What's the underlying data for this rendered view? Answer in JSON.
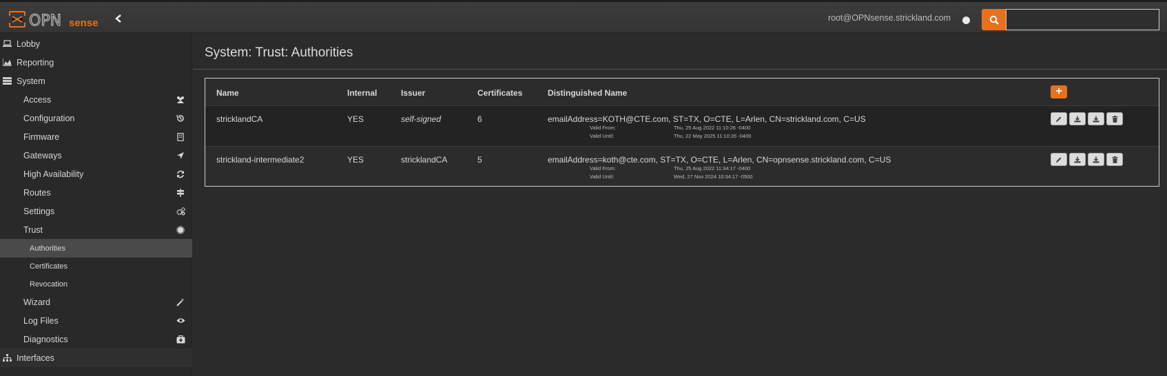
{
  "header": {
    "brand": {
      "primary": "OPN",
      "secondary": "sense"
    },
    "user": "root@OPNsense.strickland.com",
    "search_placeholder": "",
    "accent_color": "#e8711c"
  },
  "sidebar": {
    "top_items": [
      {
        "label": "Lobby",
        "icon": "laptop-icon"
      },
      {
        "label": "Reporting",
        "icon": "area-chart-icon"
      },
      {
        "label": "System",
        "icon": "server-icon"
      }
    ],
    "system_items": [
      {
        "label": "Access",
        "icon": "users-icon"
      },
      {
        "label": "Configuration",
        "icon": "history-icon"
      },
      {
        "label": "Firmware",
        "icon": "building-icon"
      },
      {
        "label": "Gateways",
        "icon": "location-arrow-icon"
      },
      {
        "label": "High Availability",
        "icon": "refresh-icon"
      },
      {
        "label": "Routes",
        "icon": "map-signs-icon"
      },
      {
        "label": "Settings",
        "icon": "cogs-icon"
      },
      {
        "label": "Trust",
        "icon": "certificate-icon"
      }
    ],
    "trust_items": [
      {
        "label": "Authorities",
        "active": true
      },
      {
        "label": "Certificates",
        "active": false
      },
      {
        "label": "Revocation",
        "active": false
      }
    ],
    "more_system_items": [
      {
        "label": "Wizard",
        "icon": "magic-icon"
      },
      {
        "label": "Log Files",
        "icon": "eye-icon"
      },
      {
        "label": "Diagnostics",
        "icon": "medkit-icon"
      }
    ],
    "bottom_items": [
      {
        "label": "Interfaces",
        "icon": "sitemap-icon"
      }
    ]
  },
  "main": {
    "title": "System: Trust: Authorities",
    "columns": [
      "Name",
      "Internal",
      "Issuer",
      "Certificates",
      "Distinguished Name"
    ],
    "rows": [
      {
        "name": "stricklandCA",
        "internal": "YES",
        "issuer": "self-signed",
        "certificates": "6",
        "dn": "emailAddress=KOTH@CTE.com, ST=TX, O=CTE, L=Arlen, CN=strickland.com, C=US",
        "valid_from_label": "Valid From:",
        "valid_from": "Thu, 25 Aug 2022 11:10:26 -0400",
        "valid_until_label": "Valid Until:",
        "valid_until": "Thu, 22 May 2025 11:10:26 -0400"
      },
      {
        "name": "strickland-intermediate2",
        "internal": "YES",
        "issuer": "stricklandCA",
        "certificates": "5",
        "dn": "emailAddress=koth@cte.com, ST=TX, O=CTE, L=Arlen, CN=opnsense.strickland.com, C=US",
        "valid_from_label": "Valid From:",
        "valid_from": "Thu, 25 Aug 2022 11:34:17 -0400",
        "valid_until_label": "Valid Until:",
        "valid_until": "Wed, 27 Nov 2024 10:34:17 -0500"
      }
    ]
  }
}
